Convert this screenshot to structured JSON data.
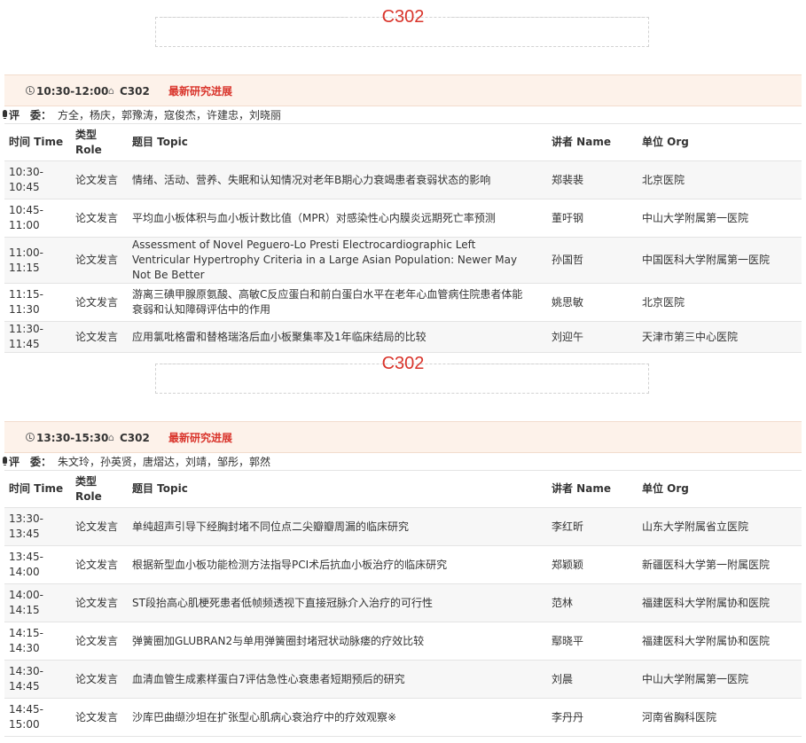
{
  "sessions": [
    {
      "room_label": "C302",
      "time": "10:30-12:00",
      "room": "C302",
      "topic": "最新研究进展",
      "judges_label": "评　委：",
      "judges": "方全，杨庆，郭豫涛，寇俊杰，许建忠，刘晓丽",
      "columns": [
        "时间 Time",
        "类型 Role",
        "题目 Topic",
        "讲者 Name",
        "单位 Org"
      ],
      "rows": [
        {
          "time": "10:30-10:45",
          "role": "论文发言",
          "topic": "情绪、活动、营养、失眠和认知情况对老年B期心力衰竭患者衰弱状态的影响",
          "name": "郑裴裴",
          "org": "北京医院"
        },
        {
          "time": "10:45-11:00",
          "role": "论文发言",
          "topic": "平均血小板体积与血小板计数比值（MPR）对感染性心内膜炎远期死亡率预测",
          "name": "董吁钢",
          "org": "中山大学附属第一医院"
        },
        {
          "time": "11:00-11:15",
          "role": "论文发言",
          "topic": "Assessment of Novel Peguero-Lo Presti Electrocardiographic Left Ventricular Hypertrophy Criteria in a Large Asian Population: Newer May Not Be Better",
          "name": "孙国哲",
          "org": "中国医科大学附属第一医院"
        },
        {
          "time": "11:15-11:30",
          "role": "论文发言",
          "topic": "游离三碘甲腺原氨酸、高敏C反应蛋白和前白蛋白水平在老年心血管病住院患者体能衰弱和认知障碍评估中的作用",
          "name": "姚思敏",
          "org": "北京医院"
        },
        {
          "time": "11:30-11:45",
          "role": "论文发言",
          "topic": "应用氯吡格雷和替格瑞洛后血小板聚集率及1年临床结局的比较",
          "name": "刘迎午",
          "org": "天津市第三中心医院"
        }
      ]
    },
    {
      "room_label": "C302",
      "time": "13:30-15:30",
      "room": "C302",
      "topic": "最新研究进展",
      "judges_label": "评　委：",
      "judges": "朱文玲，孙英贤，唐熠达，刘靖，邹彤，郭然",
      "columns": [
        "时间 Time",
        "类型 Role",
        "题目 Topic",
        "讲者 Name",
        "单位 Org"
      ],
      "rows": [
        {
          "time": "13:30-13:45",
          "role": "论文发言",
          "topic": "单纯超声引导下经胸封堵不同位点二尖瓣瓣周漏的临床研究",
          "name": "李红昕",
          "org": "山东大学附属省立医院"
        },
        {
          "time": "13:45-14:00",
          "role": "论文发言",
          "topic": "根据新型血小板功能检测方法指导PCI术后抗血小板治疗的临床研究",
          "name": "郑颖颖",
          "org": "新疆医科大学第一附属医院"
        },
        {
          "time": "14:00-14:15",
          "role": "论文发言",
          "topic": "ST段抬高心肌梗死患者低帧频透视下直接冠脉介入治疗的可行性",
          "name": "范林",
          "org": "福建医科大学附属协和医院"
        },
        {
          "time": "14:15-14:30",
          "role": "论文发言",
          "topic": "弹簧圈加GLUBRAN2与单用弹簧圈封堵冠状动脉瘘的疗效比较",
          "name": "鄢晓平",
          "org": "福建医科大学附属协和医院"
        },
        {
          "time": "14:30-14:45",
          "role": "论文发言",
          "topic": "血清血管生成素样蛋白7评估急性心衰患者短期预后的研究",
          "name": "刘晨",
          "org": "中山大学附属第一医院"
        },
        {
          "time": "14:45-15:00",
          "role": "论文发言",
          "topic": "沙库巴曲缬沙坦在扩张型心肌病心衰治疗中的疗效观察※",
          "name": "李丹丹",
          "org": "河南省胸科医院"
        }
      ]
    }
  ]
}
